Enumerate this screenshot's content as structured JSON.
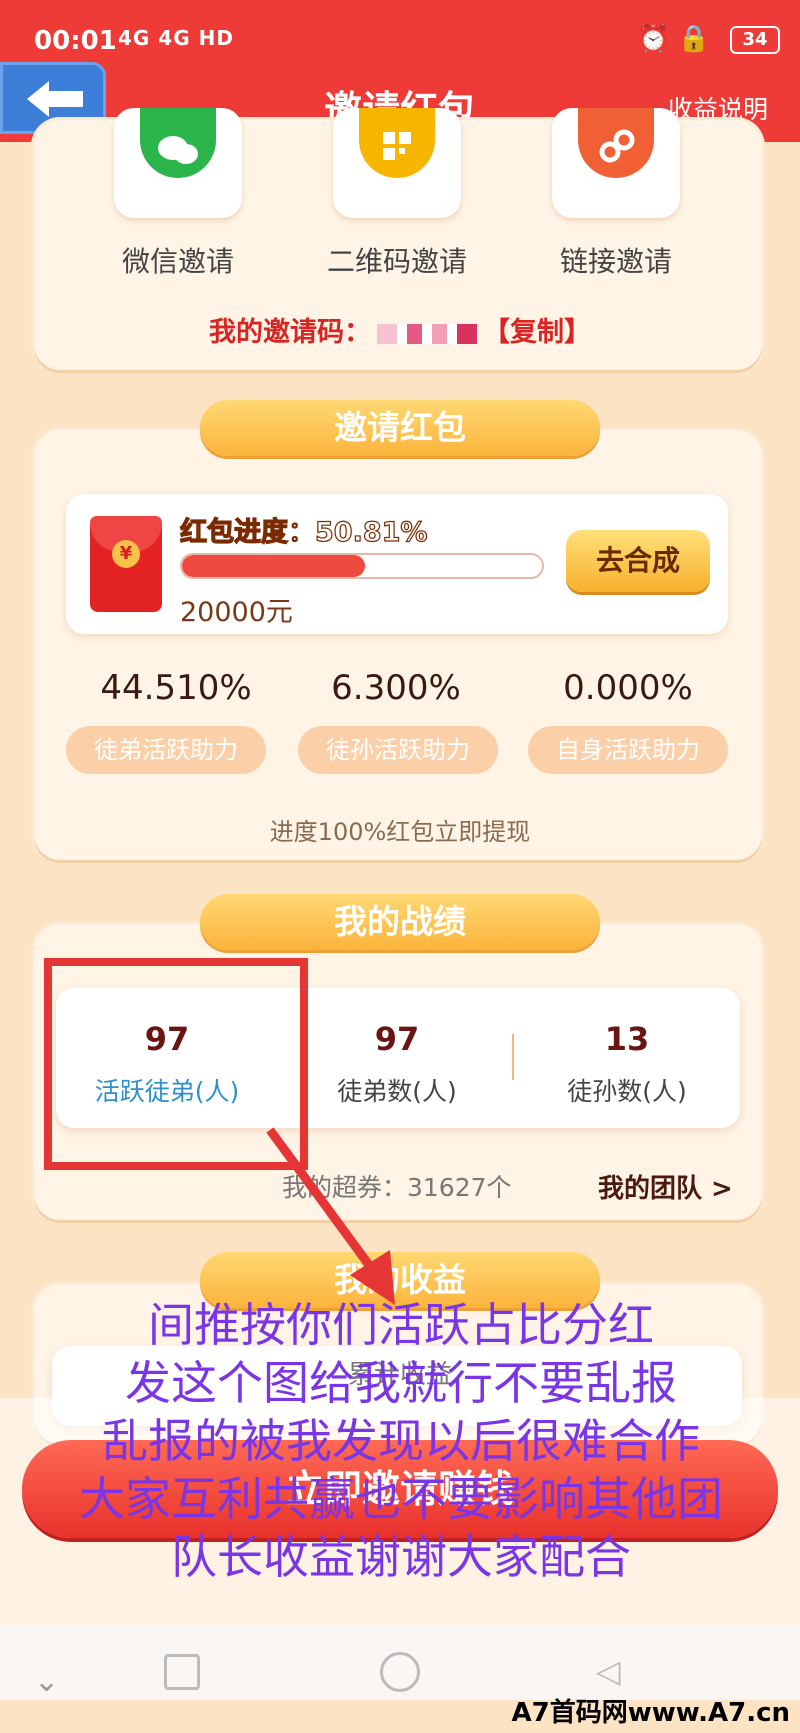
{
  "status": {
    "time": "00:01",
    "network": "4G 4G HD",
    "battery": "34"
  },
  "header": {
    "title": "邀请红包",
    "right_link": "收益说明"
  },
  "share": {
    "items": [
      {
        "label": "微信邀请",
        "icon": "wechat-icon",
        "color": "#2bb44a"
      },
      {
        "label": "二维码邀请",
        "icon": "qrcode-icon",
        "color": "#f7b500"
      },
      {
        "label": "链接邀请",
        "icon": "link-icon",
        "color": "#f06034"
      }
    ],
    "invite_code_label": "我的邀请码：",
    "copy_label": "【复制】"
  },
  "redpacket": {
    "section_title": "邀请红包",
    "progress_label": "红包进度：50.81%",
    "progress": 50.81,
    "amount": "20000元",
    "button": "去合成",
    "stats": [
      {
        "value": "44.510%",
        "label": "徒弟活跃助力"
      },
      {
        "value": "6.300%",
        "label": "徒孙活跃助力"
      },
      {
        "value": "0.000%",
        "label": "自身活跃助力"
      }
    ],
    "hint": "进度100%红包立即提现"
  },
  "record": {
    "section_title": "我的战绩",
    "items": [
      {
        "value": "97",
        "label": "活跃徒弟(人)"
      },
      {
        "value": "97",
        "label": "徒弟数(人)"
      },
      {
        "value": "13",
        "label": "徒孙数(人)"
      }
    ],
    "coupons": "我的超券：31627个",
    "team_link": "我的团队 >"
  },
  "income": {
    "section_title": "我的收益",
    "total_label": "累计收益"
  },
  "cta": "立即邀请赚钱",
  "overlay": [
    "间推按你们活跃占比分红",
    "发这个图给我就行不要乱报",
    "乱报的被我发现以后很难合作",
    "大家互利共赢也不要影响其他团队长收益谢谢大家配合"
  ],
  "watermark": "A7首码网www.A7.cn",
  "colors": {
    "primary_red": "#ee3b38",
    "accent_gold": "#fbb43b",
    "annotation_purple": "#7a35e6"
  }
}
